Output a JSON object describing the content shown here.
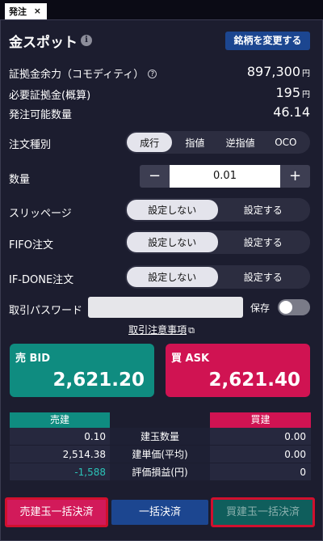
{
  "tab": {
    "label": "発注",
    "close": "×"
  },
  "header": {
    "title": "金スポット",
    "info_icon": "i",
    "change_button": "銘柄を変更する"
  },
  "summary": [
    {
      "label": "証拠金余力（コモディティ）",
      "has_help": true,
      "value": "897,300",
      "unit": "円"
    },
    {
      "label": "必要証拠金(概算)",
      "has_help": false,
      "value": "195",
      "unit": "円"
    },
    {
      "label": "発注可能数量",
      "has_help": false,
      "value": "46.14",
      "unit": ""
    }
  ],
  "order_type": {
    "label": "注文種別",
    "options": [
      "成行",
      "指値",
      "逆指値",
      "OCO"
    ],
    "selected": "成行"
  },
  "quantity": {
    "label": "数量",
    "value": "0.01",
    "minus": "−",
    "plus": "+"
  },
  "slippage": {
    "label": "スリッページ",
    "options": [
      "設定しない",
      "設定する"
    ],
    "selected": "設定しない"
  },
  "fifo": {
    "label": "FIFO注文",
    "options": [
      "設定しない",
      "設定する"
    ],
    "selected": "設定しない"
  },
  "ifdone": {
    "label": "IF-DONE注文",
    "options": [
      "設定しない",
      "設定する"
    ],
    "selected": "設定しない"
  },
  "password": {
    "label": "取引パスワード",
    "value": "",
    "save_label": "保存",
    "save_enabled": false
  },
  "notice_link": "取引注意事項",
  "bid": {
    "label": "売 BID",
    "price": "2,621.20",
    "color": "#0f8c80"
  },
  "ask": {
    "label": "買 ASK",
    "price": "2,621.40",
    "color": "#d01352"
  },
  "positions": {
    "sell_header": "売建",
    "buy_header": "買建",
    "rows": [
      {
        "sell": "0.10",
        "label": "建玉数量",
        "buy": "0.00"
      },
      {
        "sell": "2,514.38",
        "label": "建単価(平均)",
        "buy": "0.00"
      },
      {
        "sell": "-1,588",
        "label": "評価損益(円)",
        "buy": "0"
      }
    ]
  },
  "actions": {
    "sell_all": "売建玉一括決済",
    "settle_all": "一括決済",
    "buy_all": "買建玉一括決済"
  }
}
